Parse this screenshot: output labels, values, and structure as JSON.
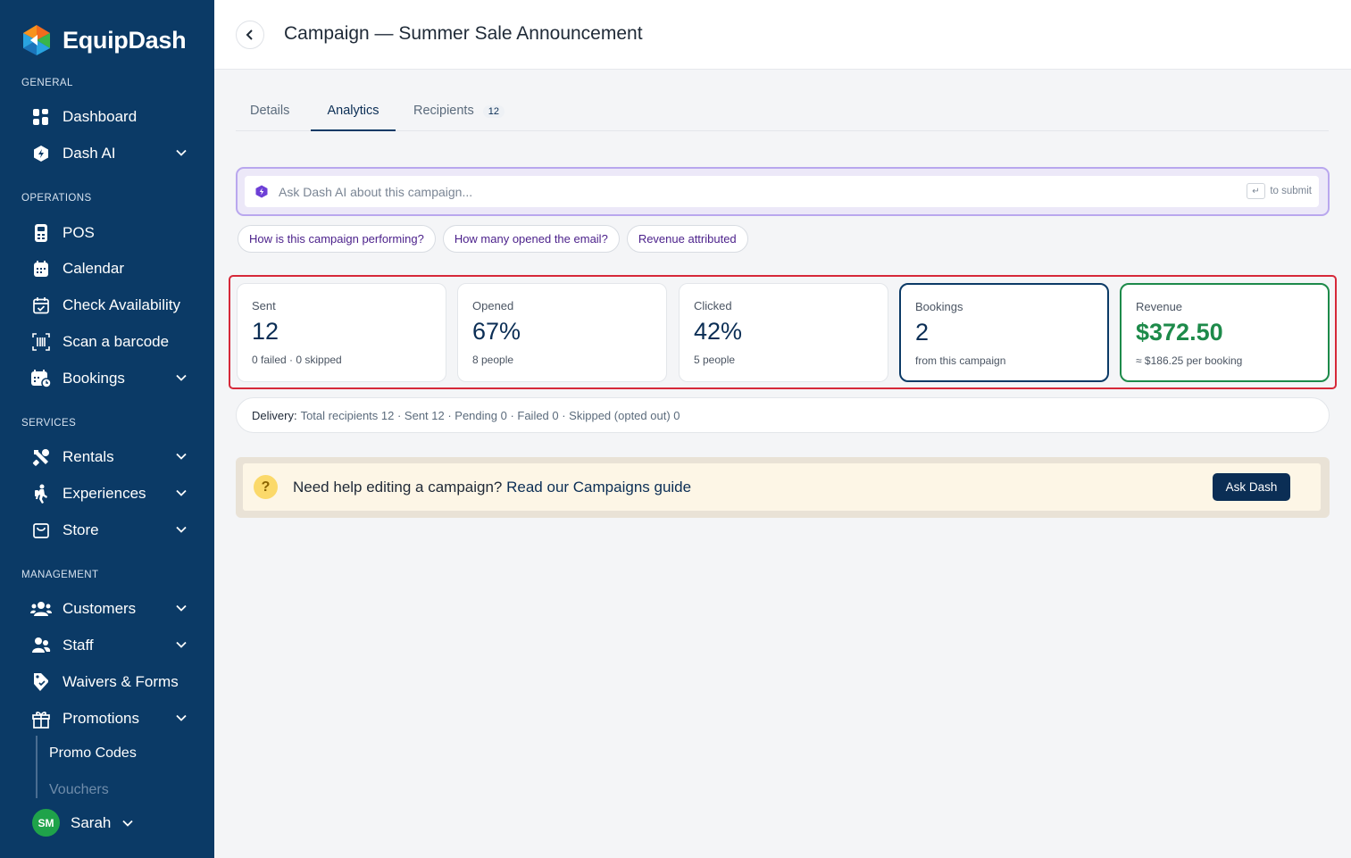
{
  "brand": {
    "name": "EquipDash"
  },
  "sidebar": {
    "sections": {
      "general": "GENERAL",
      "operations": "OPERATIONS",
      "services": "SERVICES",
      "management": "MANAGEMENT"
    },
    "items": {
      "dashboard": "Dashboard",
      "dash_ai": "Dash AI",
      "pos": "POS",
      "calendar": "Calendar",
      "check_availability": "Check Availability",
      "scan_barcode": "Scan a barcode",
      "bookings": "Bookings",
      "rentals": "Rentals",
      "experiences": "Experiences",
      "store": "Store",
      "customers": "Customers",
      "staff": "Staff",
      "waivers": "Waivers & Forms",
      "promotions": "Promotions",
      "promo_codes": "Promo Codes",
      "vouchers": "Vouchers"
    },
    "user": {
      "initials": "SM",
      "name": "Sarah"
    }
  },
  "header": {
    "title": "Campaign — Summer Sale Announcement"
  },
  "tabs": [
    {
      "label": "Details"
    },
    {
      "label": "Analytics"
    },
    {
      "label": "Recipients",
      "count": "12"
    }
  ],
  "ask": {
    "placeholder": "Ask Dash AI about this campaign...",
    "key_glyph": "↵",
    "hint": "to submit",
    "chips": [
      "How is this campaign performing?",
      "How many opened the email?",
      "Revenue attributed"
    ]
  },
  "stats": [
    {
      "label": "Sent",
      "value": "12",
      "sub": "0 failed · 0 skipped"
    },
    {
      "label": "Opened",
      "value": "67%",
      "sub": "8 people"
    },
    {
      "label": "Clicked",
      "value": "42%",
      "sub": "5 people"
    },
    {
      "label": "Bookings",
      "value": "2",
      "sub": "from this campaign"
    },
    {
      "label": "Revenue",
      "value": "$372.50",
      "sub": "≈ $186.25 per booking"
    }
  ],
  "delivery": {
    "label": "Delivery:",
    "text": "Total recipients 12 · Sent 12 · Pending 0 · Failed 0 · Skipped (opted out) 0"
  },
  "help": {
    "text": "Need help editing a campaign?",
    "link": "Read our Campaigns guide",
    "button": "Ask Dash"
  },
  "colors": {
    "sidebar": "#0b3a66",
    "accent_purple": "#6d3fd6",
    "revenue_green": "#1d8a4a",
    "highlight_red": "#d62839"
  }
}
